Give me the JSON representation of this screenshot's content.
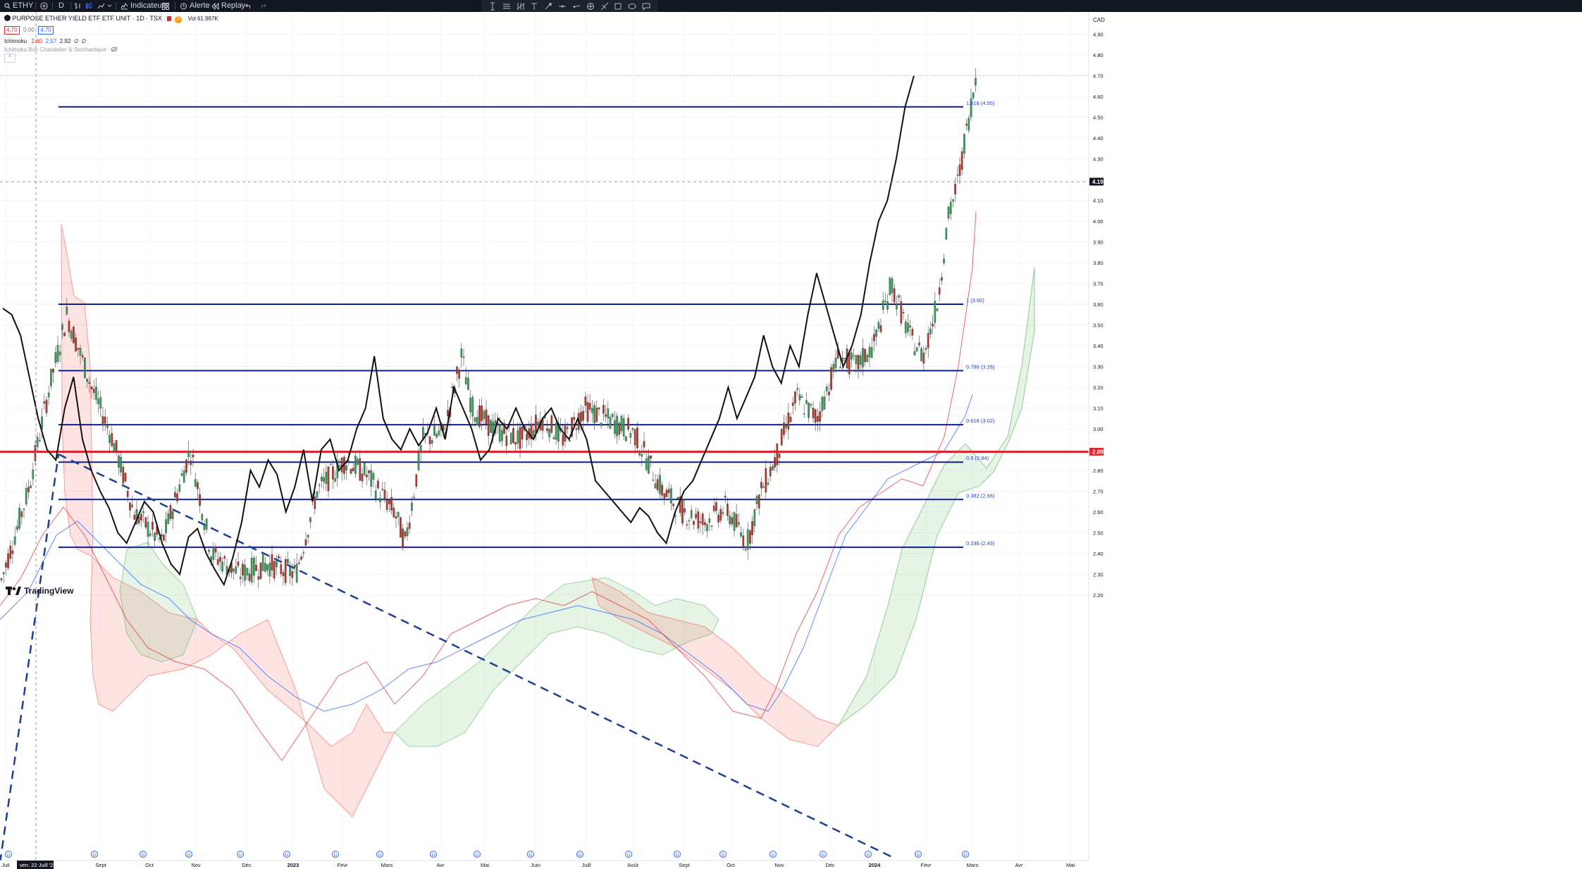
{
  "toolbar": {
    "symbol": "ETHY",
    "interval": "D",
    "indicators_label": "Indicateurs",
    "alert_label": "Alerte",
    "replay_label": "Replay"
  },
  "legend": {
    "title": "PURPOSE ETHER YIELD ETF ETF UNIT · 1D · TSX",
    "flag_d": "D",
    "volume": "Vol 61.987K",
    "bid": "4.70",
    "spread": "0.00",
    "ask": "4.70",
    "ichimoku_name": "Ichimoku",
    "ichimoku_values": [
      "2.60",
      "2.57",
      "2.92",
      "∅",
      "∅"
    ],
    "indicator2_name": "Ichimoku Box Chandelier & Stochastique",
    "collapse_glyph": "^"
  },
  "price_axis": {
    "currency": "CAD",
    "ticks": [
      "4.90",
      "4.80",
      "4.70",
      "4.60",
      "4.50",
      "4.40",
      "4.30",
      "4.20",
      "4.10",
      "4.00",
      "3.90",
      "3.80",
      "3.70",
      "3.60",
      "3.50",
      "3.40",
      "3.30",
      "3.20",
      "3.10",
      "3.00",
      "2.90",
      "2.80",
      "2.70",
      "2.60",
      "2.50",
      "2.40",
      "2.30",
      "2.20"
    ],
    "current_price_label": "4.19",
    "red_level_label": "2.89"
  },
  "time_axis": {
    "labels": [
      "Juil",
      "Sept",
      "Oct",
      "Nov",
      "Déc",
      "2023",
      "Févr",
      "Mars",
      "Avr",
      "Mai",
      "Juin",
      "Juill",
      "Août",
      "Sept",
      "Oct",
      "Nov",
      "Déc",
      "2024",
      "Févr",
      "Mars",
      "Avr",
      "Mai"
    ],
    "crosshair_label": "ven. 22 Juill '22"
  },
  "chart_data": {
    "type": "candlestick",
    "symbol": "ETHY",
    "exchange": "TSX",
    "interval": "1D",
    "y_range": [
      2.2,
      4.95
    ],
    "last_price": 4.7,
    "crosshair_price": 4.19,
    "horizontal_line_red": 2.89,
    "fibonacci_levels": [
      {
        "ratio": "1",
        "price": 3.6,
        "label": "1 (3.60)"
      },
      {
        "ratio": "0.786",
        "price": 3.28,
        "label": "0.786 (3.28)"
      },
      {
        "ratio": "0.618",
        "price": 3.02,
        "label": "0.618 (3.02)"
      },
      {
        "ratio": "0.5",
        "price": 2.84,
        "label": "0.5 (2.84)"
      },
      {
        "ratio": "0.382",
        "price": 2.66,
        "label": "0.382 (2.66)"
      },
      {
        "ratio": "0.236",
        "price": 2.43,
        "label": "0.236 (2.43)"
      },
      {
        "ratio": "1.618",
        "price": 4.55,
        "label": "1.618 (4.55)"
      }
    ],
    "overlay_line_points": [
      [
        0,
        3.58
      ],
      [
        1,
        3.55
      ],
      [
        2,
        3.45
      ],
      [
        3,
        3.25
      ],
      [
        4,
        3.05
      ],
      [
        5,
        2.9
      ],
      [
        6,
        2.85
      ],
      [
        7,
        3.1
      ],
      [
        8,
        3.25
      ],
      [
        9,
        2.95
      ],
      [
        10,
        2.8
      ],
      [
        11,
        2.7
      ],
      [
        12,
        2.62
      ],
      [
        13,
        2.5
      ],
      [
        14,
        2.45
      ],
      [
        15,
        2.55
      ],
      [
        16,
        2.65
      ],
      [
        17,
        2.6
      ],
      [
        18,
        2.45
      ],
      [
        19,
        2.35
      ],
      [
        20,
        2.3
      ],
      [
        21,
        2.48
      ],
      [
        22,
        2.52
      ],
      [
        23,
        2.4
      ],
      [
        24,
        2.32
      ],
      [
        25,
        2.25
      ],
      [
        26,
        2.38
      ],
      [
        27,
        2.55
      ],
      [
        28,
        2.8
      ],
      [
        29,
        2.72
      ],
      [
        30,
        2.85
      ],
      [
        31,
        2.78
      ],
      [
        32,
        2.6
      ],
      [
        33,
        2.72
      ],
      [
        34,
        2.9
      ],
      [
        35,
        2.65
      ],
      [
        36,
        2.9
      ],
      [
        37,
        2.95
      ],
      [
        38,
        2.8
      ],
      [
        39,
        2.85
      ],
      [
        40,
        3.0
      ],
      [
        41,
        3.1
      ],
      [
        42,
        3.35
      ],
      [
        43,
        3.05
      ],
      [
        44,
        2.95
      ],
      [
        45,
        2.9
      ],
      [
        46,
        3.0
      ],
      [
        47,
        2.92
      ],
      [
        48,
        2.98
      ],
      [
        49,
        3.1
      ],
      [
        50,
        2.95
      ],
      [
        51,
        3.2
      ],
      [
        52,
        3.1
      ],
      [
        53,
        3.0
      ],
      [
        54,
        2.85
      ],
      [
        55,
        2.9
      ],
      [
        56,
        3.05
      ],
      [
        57,
        3.0
      ],
      [
        58,
        3.1
      ],
      [
        59,
        3.0
      ],
      [
        60,
        2.95
      ],
      [
        61,
        3.05
      ],
      [
        62,
        3.1
      ],
      [
        63,
        3.0
      ],
      [
        64,
        2.95
      ],
      [
        65,
        3.05
      ],
      [
        66,
        2.95
      ],
      [
        67,
        2.75
      ],
      [
        68,
        2.7
      ],
      [
        69,
        2.65
      ],
      [
        70,
        2.6
      ],
      [
        71,
        2.55
      ],
      [
        72,
        2.62
      ],
      [
        73,
        2.58
      ],
      [
        74,
        2.5
      ],
      [
        75,
        2.45
      ],
      [
        76,
        2.6
      ],
      [
        77,
        2.7
      ],
      [
        78,
        2.75
      ],
      [
        79,
        2.85
      ],
      [
        80,
        2.95
      ],
      [
        81,
        3.05
      ],
      [
        82,
        3.2
      ],
      [
        83,
        3.05
      ],
      [
        84,
        3.15
      ],
      [
        85,
        3.25
      ],
      [
        86,
        3.45
      ],
      [
        87,
        3.3
      ],
      [
        88,
        3.22
      ],
      [
        89,
        3.4
      ],
      [
        90,
        3.3
      ],
      [
        91,
        3.55
      ],
      [
        92,
        3.75
      ],
      [
        93,
        3.6
      ],
      [
        94,
        3.45
      ],
      [
        95,
        3.3
      ],
      [
        96,
        3.4
      ],
      [
        97,
        3.55
      ],
      [
        98,
        3.8
      ],
      [
        99,
        4.0
      ],
      [
        100,
        4.1
      ],
      [
        101,
        4.3
      ],
      [
        102,
        4.55
      ],
      [
        103,
        4.7
      ]
    ],
    "ichimoku": {
      "tenkan": 2.6,
      "kijun": 2.57,
      "senkou_b": 2.92
    }
  }
}
